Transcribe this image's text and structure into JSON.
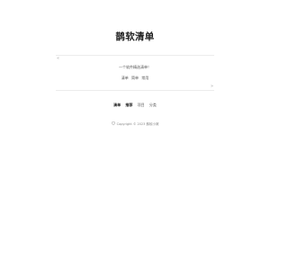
{
  "site": {
    "title": "鹊软清单"
  },
  "quote": {
    "open_mark": "«",
    "close_mark": "»",
    "text": "一个软件精选清单！",
    "links": [
      "清单",
      "简单",
      "常用"
    ]
  },
  "nav": {
    "items": [
      "清单",
      "推荐",
      "项目",
      "分类"
    ]
  },
  "footer": {
    "icon": "shield-icon",
    "text": "Copyright © 2023 鹊软小窝"
  }
}
